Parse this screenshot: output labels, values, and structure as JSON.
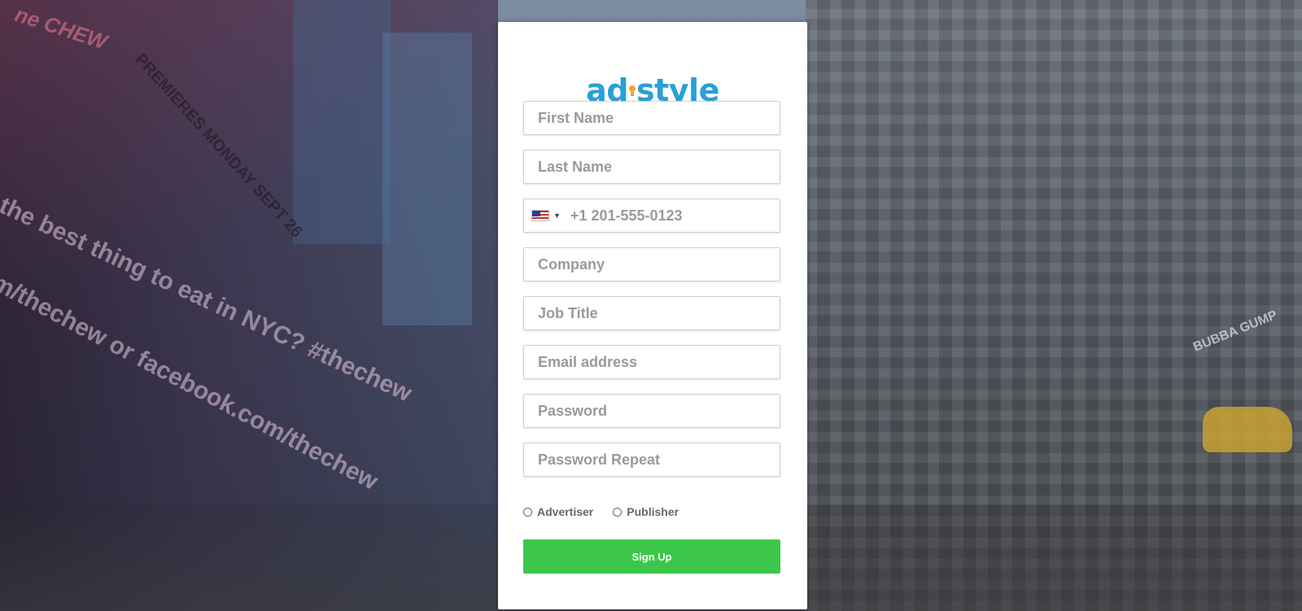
{
  "brand": {
    "logo_text": "adstyle",
    "logo_color": "#2a9fd8",
    "bulb_color": "#f0a52a"
  },
  "background": {
    "sign_text_1": "the best thing to eat in NYC? #thechew",
    "sign_text_2": "m/thechew or facebook.com/thechew",
    "sign_text_3": "PREMIERES MONDAY SEPT 26",
    "sign_text_4": "ne CHEW",
    "sign_text_5": "BUBBA GUMP"
  },
  "form": {
    "first_name_placeholder": "First Name",
    "last_name_placeholder": "Last Name",
    "phone_country": "US",
    "phone_placeholder": "+1 201-555-0123",
    "company_placeholder": "Company",
    "job_title_placeholder": "Job Title",
    "email_placeholder": "Email address",
    "password_placeholder": "Password",
    "password_repeat_placeholder": "Password Repeat",
    "roles": [
      "Advertiser",
      "Publisher"
    ],
    "submit_label": "Sign Up",
    "submit_color": "#3cc74a"
  }
}
